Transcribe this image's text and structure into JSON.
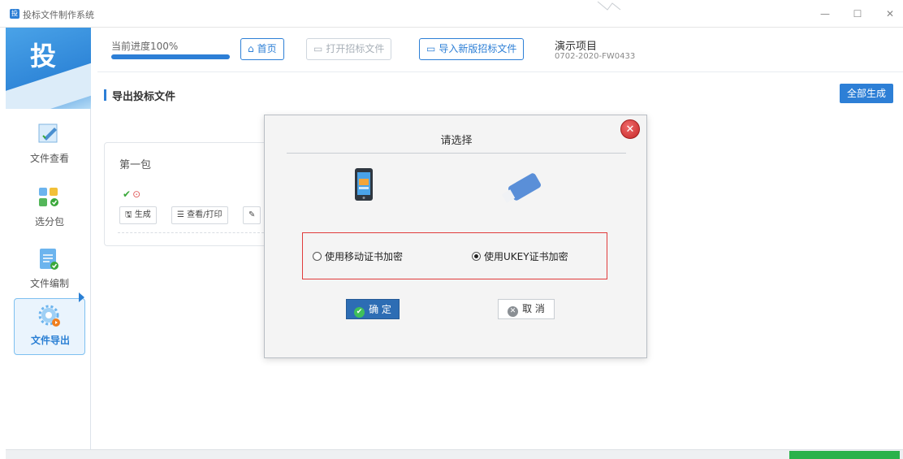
{
  "window": {
    "title": "投标文件制作系统",
    "minimize": "—",
    "maximize": "☐",
    "close": "✕"
  },
  "sidebar": {
    "logo_char": "投",
    "items": [
      {
        "label": "文件查看",
        "icon": "document-edit-icon"
      },
      {
        "label": "选分包",
        "icon": "package-select-icon"
      },
      {
        "label": "文件编制",
        "icon": "document-compose-icon"
      },
      {
        "label": "文件导出",
        "icon": "export-gear-icon",
        "active": true
      }
    ]
  },
  "header": {
    "progress_label": "当前进度100%",
    "progress_value": 1.0,
    "buttons": [
      {
        "label": "首页",
        "icon": "home-icon",
        "enabled": true
      },
      {
        "label": "打开招标文件",
        "icon": "folder-open-icon",
        "enabled": false
      },
      {
        "label": "导入新版招标文件",
        "icon": "folder-open-icon",
        "enabled": true
      }
    ],
    "project_name": "演示项目",
    "project_code": "0702-2020-FW0433"
  },
  "main": {
    "section_title": "导出投标文件",
    "generate_all_label": "全部生成",
    "package_card": {
      "title": "第一包",
      "status_ok": "✔",
      "status_dot": "⊙",
      "buttons": [
        {
          "label": "生成",
          "icon": "save-icon"
        },
        {
          "label": "查看/打印",
          "icon": "list-icon"
        },
        {
          "label": "",
          "icon": "edit-icon"
        }
      ]
    }
  },
  "modal": {
    "title": "请选择",
    "options": [
      {
        "label": "使用移动证书加密",
        "selected": false
      },
      {
        "label": "使用UKEY证书加密",
        "selected": true
      }
    ],
    "ok_label": "确 定",
    "cancel_label": "取 消",
    "close_glyph": "✕"
  },
  "colors": {
    "accent": "#2d7fd6",
    "confirm": "#2d6db4",
    "highlight_border": "#e03b3b",
    "status_green": "#2ab24a"
  }
}
